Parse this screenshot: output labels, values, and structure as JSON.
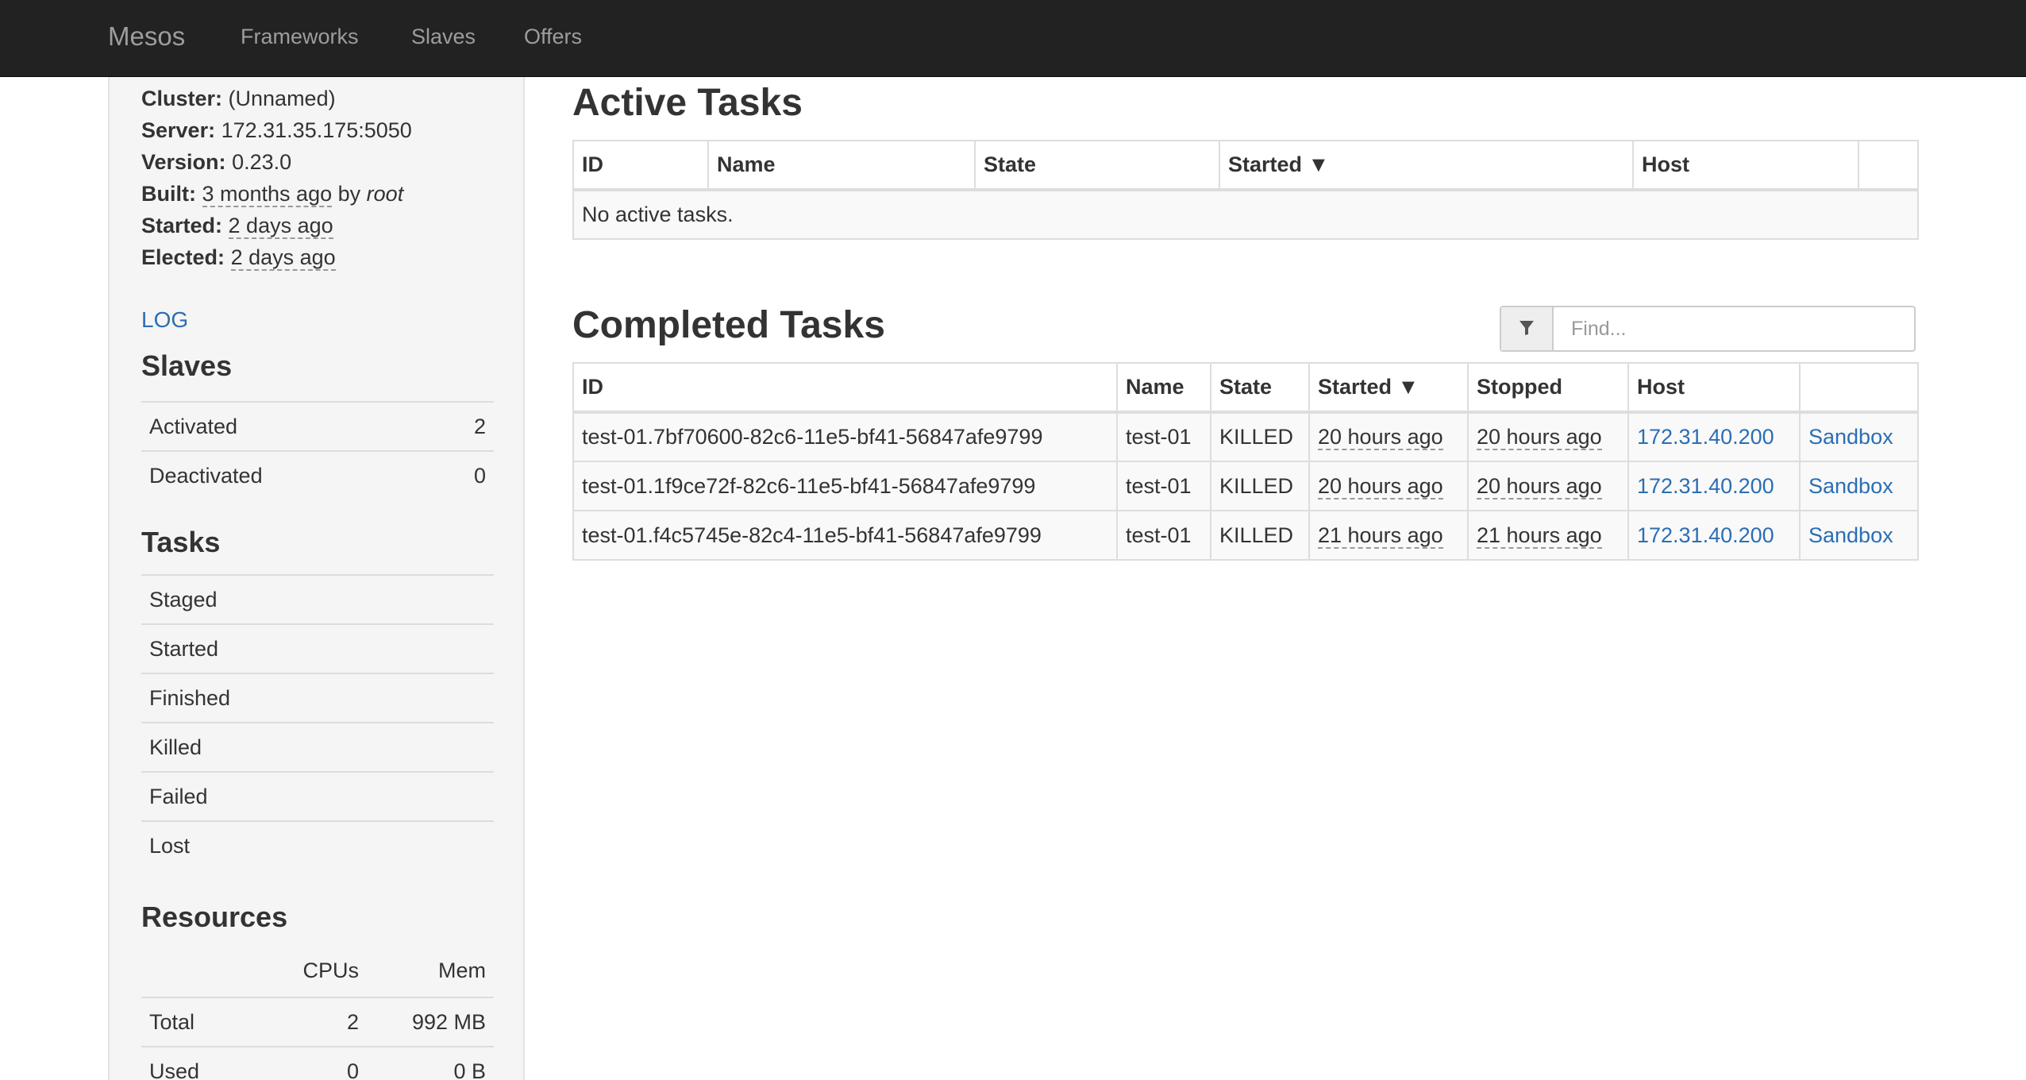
{
  "navbar": {
    "brand": "Mesos",
    "links": [
      "Frameworks",
      "Slaves",
      "Offers"
    ]
  },
  "sidebar": {
    "cluster_label": "Cluster:",
    "cluster_value": "(Unnamed)",
    "server_label": "Server:",
    "server_value": "172.31.35.175:5050",
    "version_label": "Version:",
    "version_value": "0.23.0",
    "built_label": "Built:",
    "built_time": "3 months ago",
    "built_by": "by",
    "built_user": "root",
    "started_label": "Started:",
    "started_value": "2 days ago",
    "elected_label": "Elected:",
    "elected_value": "2 days ago",
    "log_link": "LOG",
    "slaves_heading": "Slaves",
    "slaves": [
      {
        "label": "Activated",
        "value": "2"
      },
      {
        "label": "Deactivated",
        "value": "0"
      }
    ],
    "tasks_heading": "Tasks",
    "tasks": [
      "Staged",
      "Started",
      "Finished",
      "Killed",
      "Failed",
      "Lost"
    ],
    "resources_heading": "Resources",
    "resources_columns": [
      "CPUs",
      "Mem"
    ],
    "resources": [
      {
        "label": "Total",
        "cpus": "2",
        "mem": "992 MB"
      },
      {
        "label": "Used",
        "cpus": "0",
        "mem": "0 B"
      }
    ]
  },
  "active_tasks": {
    "heading": "Active Tasks",
    "columns": [
      "ID",
      "Name",
      "State",
      "Started ▼",
      "Host",
      ""
    ],
    "empty_message": "No active tasks."
  },
  "completed_tasks": {
    "heading": "Completed Tasks",
    "filter_placeholder": "Find...",
    "columns": [
      "ID",
      "Name",
      "State",
      "Started ▼",
      "Stopped",
      "Host",
      ""
    ],
    "rows": [
      {
        "id": "test-01.7bf70600-82c6-11e5-bf41-56847afe9799",
        "name": "test-01",
        "state": "KILLED",
        "started": "20 hours ago",
        "stopped": "20 hours ago",
        "host": "172.31.40.200",
        "link": "Sandbox"
      },
      {
        "id": "test-01.1f9ce72f-82c6-11e5-bf41-56847afe9799",
        "name": "test-01",
        "state": "KILLED",
        "started": "20 hours ago",
        "stopped": "20 hours ago",
        "host": "172.31.40.200",
        "link": "Sandbox"
      },
      {
        "id": "test-01.f4c5745e-82c4-11e5-bf41-56847afe9799",
        "name": "test-01",
        "state": "KILLED",
        "started": "21 hours ago",
        "stopped": "21 hours ago",
        "host": "172.31.40.200",
        "link": "Sandbox"
      }
    ]
  }
}
